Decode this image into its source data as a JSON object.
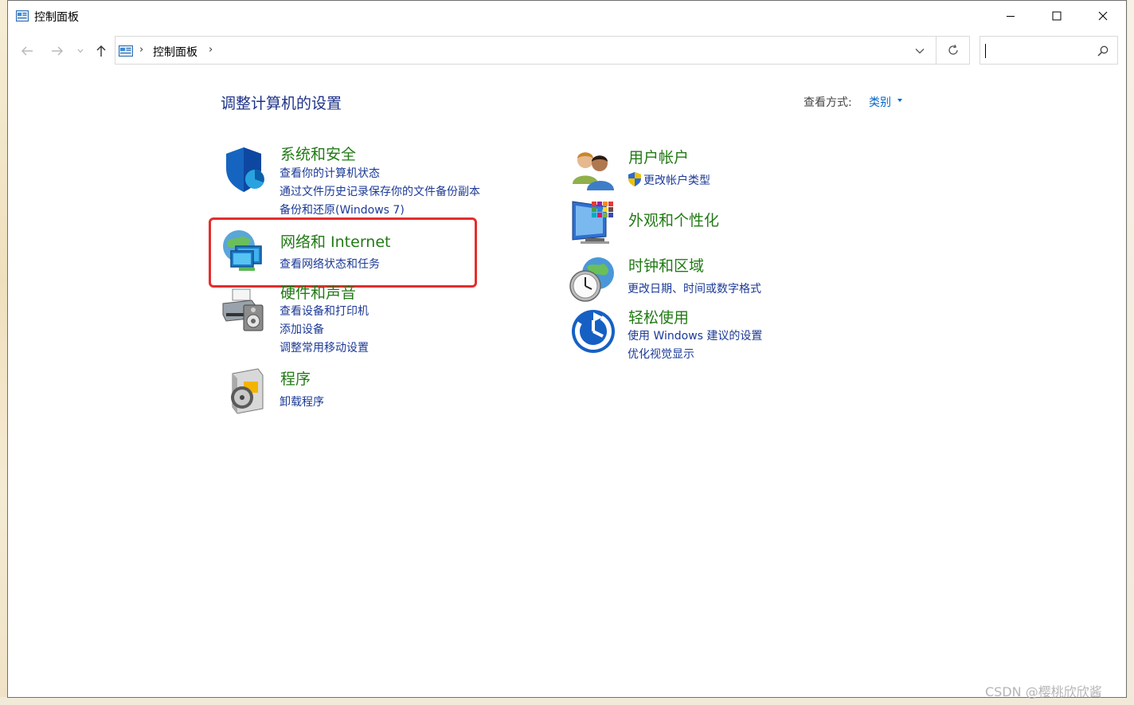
{
  "window": {
    "title": "控制面板",
    "controls": {
      "minimize": "—",
      "maximize": "☐",
      "close": "✕"
    }
  },
  "nav": {
    "back_icon": "back-arrow-icon",
    "forward_icon": "forward-arrow-icon",
    "up_icon": "up-arrow-icon",
    "breadcrumb": [
      "控制面板"
    ],
    "search_placeholder": ""
  },
  "main": {
    "title": "调整计算机的设置",
    "view_by_label": "查看方式:",
    "view_by_value": "类别"
  },
  "categories": [
    {
      "title": "系统和安全",
      "icon": "shield-icon",
      "links": [
        "查看你的计算机状态",
        "通过文件历史记录保存你的文件备份副本",
        "备份和还原(Windows 7)"
      ]
    },
    {
      "title": "网络和 Internet",
      "icon": "network-globe-icon",
      "links": [
        "查看网络状态和任务"
      ]
    },
    {
      "title": "硬件和声音",
      "icon": "printer-speaker-icon",
      "links": [
        "查看设备和打印机",
        "添加设备",
        "调整常用移动设置"
      ]
    },
    {
      "title": "程序",
      "icon": "programs-disc-icon",
      "links": [
        "卸载程序"
      ]
    },
    {
      "title": "用户帐户",
      "icon": "users-icon",
      "links": [
        "更改帐户类型"
      ]
    },
    {
      "title": "外观和个性化",
      "icon": "monitor-palette-icon",
      "links": []
    },
    {
      "title": "时钟和区域",
      "icon": "clock-globe-icon",
      "links": [
        "更改日期、时间或数字格式"
      ]
    },
    {
      "title": "轻松使用",
      "icon": "ease-of-access-icon",
      "links": [
        "使用 Windows 建议的设置",
        "优化视觉显示"
      ]
    }
  ],
  "watermark": "CSDN @樱桃欣欣酱",
  "colors": {
    "category_title": "#227a15",
    "link": "#1c3a96",
    "page_title": "#1e3287",
    "highlight": "#e52d2d"
  }
}
